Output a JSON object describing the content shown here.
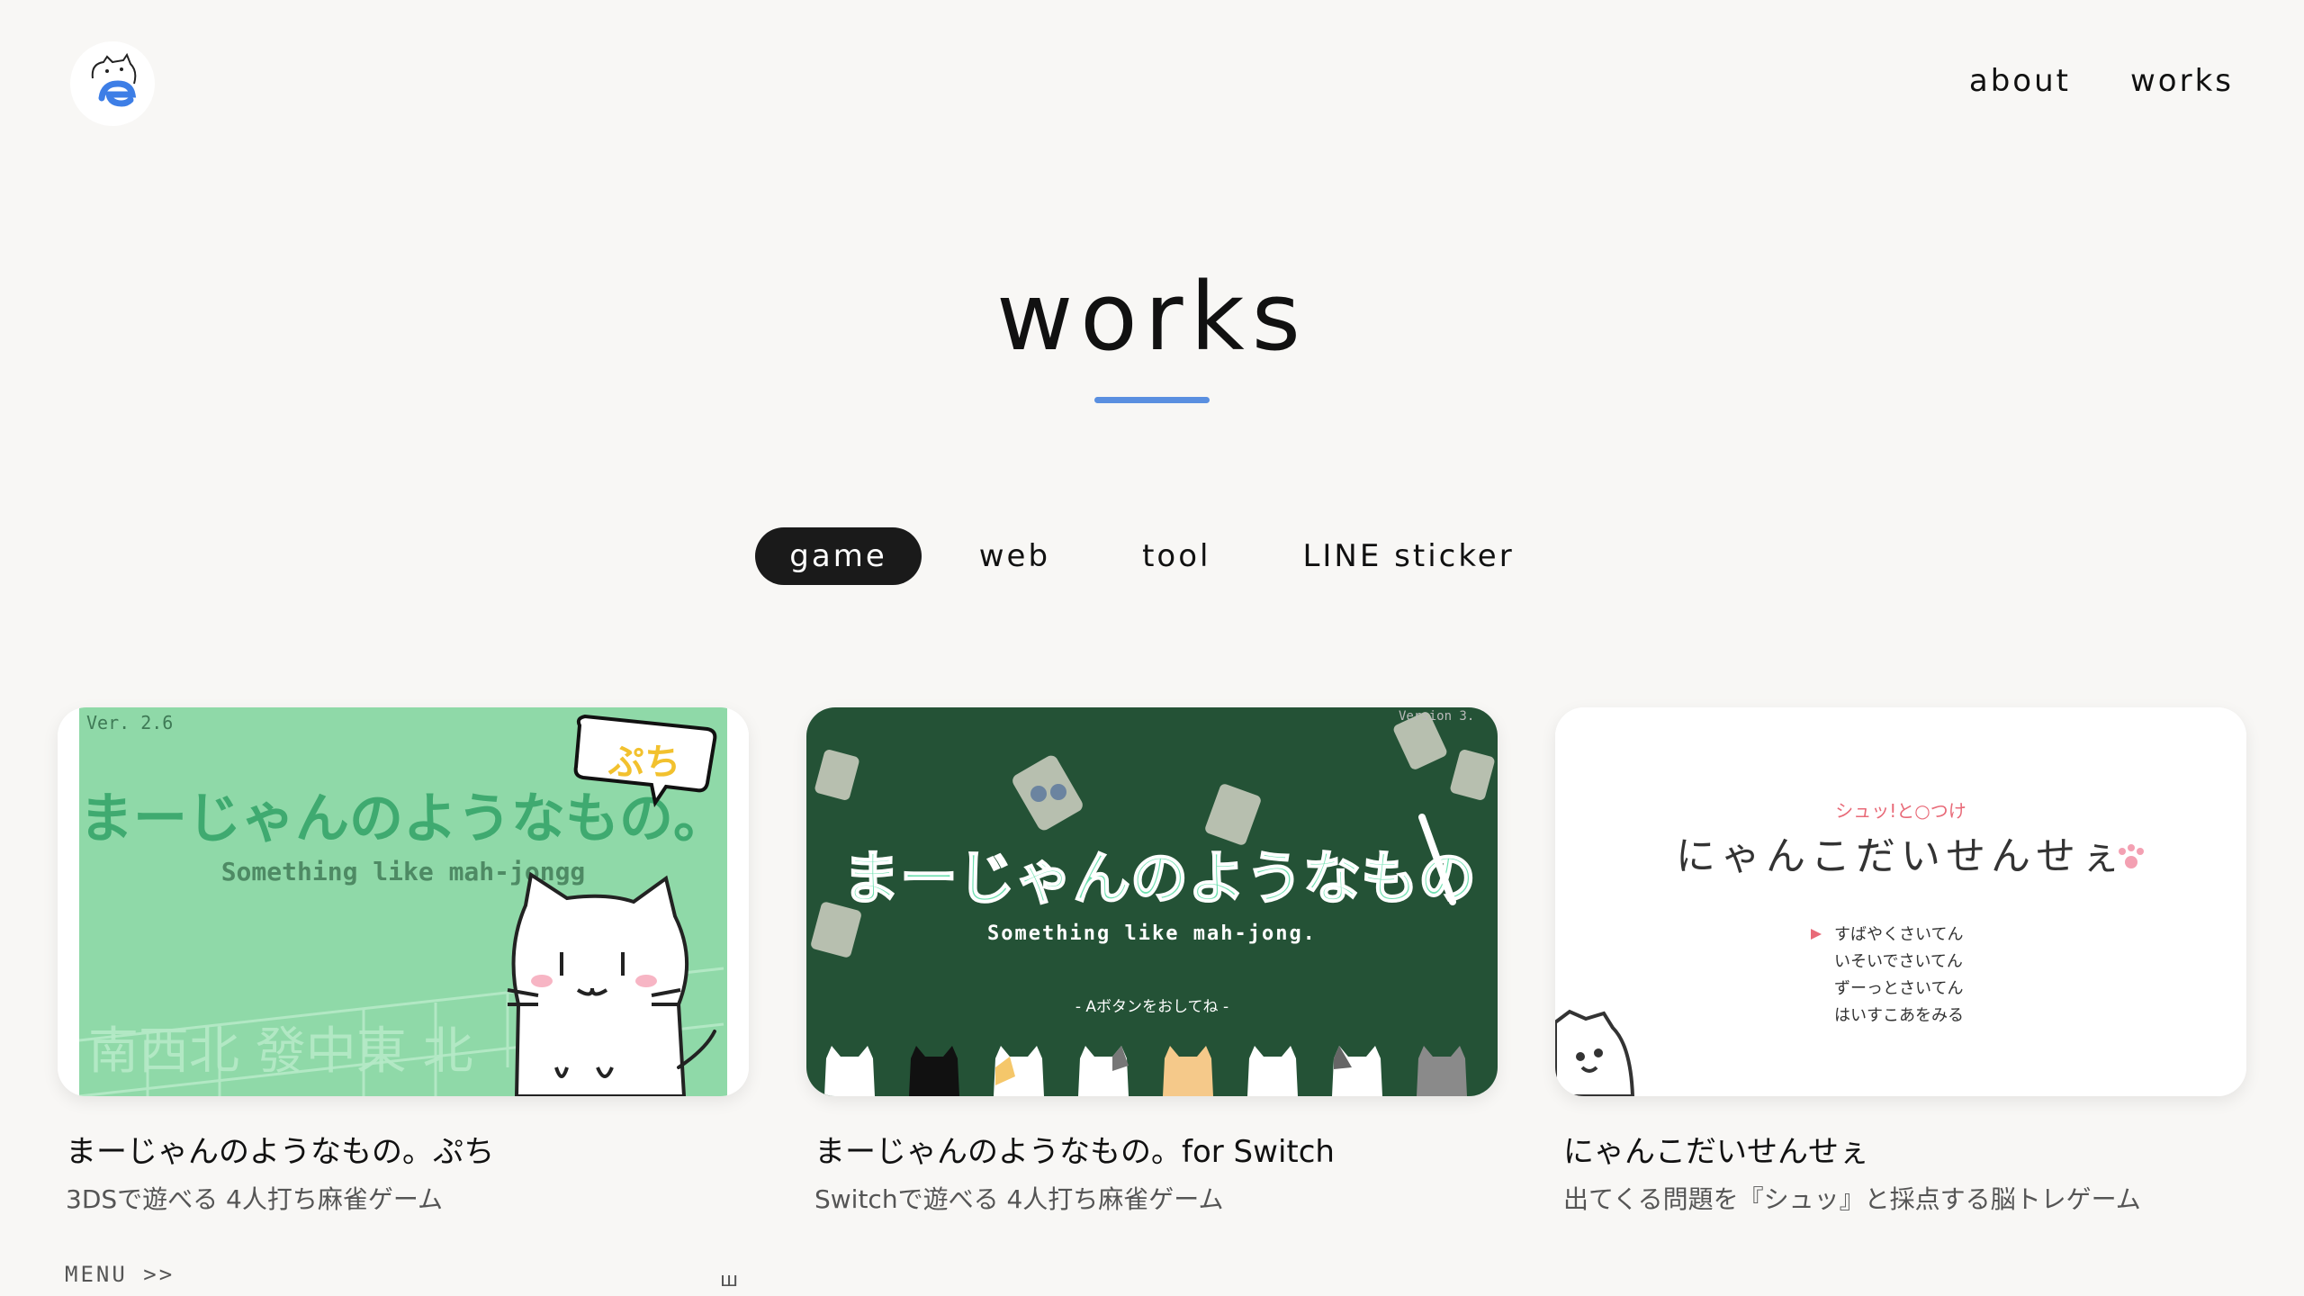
{
  "header": {
    "nav": [
      {
        "label": "about"
      },
      {
        "label": "works"
      }
    ]
  },
  "page": {
    "title": "works"
  },
  "tabs": [
    {
      "label": "game",
      "active": true
    },
    {
      "label": "web",
      "active": false
    },
    {
      "label": "tool",
      "active": false
    },
    {
      "label": "LINE sticker",
      "active": false
    }
  ],
  "cards": [
    {
      "title": "まーじゃんのようなもの。ぷち",
      "description": "3DSで遊べる 4人打ち麻雀ゲーム",
      "thumb": {
        "version": "Ver. 2.6",
        "logo": "まーじゃんのようなもの。",
        "subtitle": "Something like mah-jongg",
        "badge": "ぷち",
        "tiles": "南西北 發中東 北"
      }
    },
    {
      "title": "まーじゃんのようなもの。for Switch",
      "description": "Switchで遊べる 4人打ち麻雀ゲーム",
      "thumb": {
        "version": "Version 3.",
        "logo": "まーじゃんのようなもの",
        "subtitle": "Something like mah-jong.",
        "prompt": "- Aボタンをおしてね -"
      }
    },
    {
      "title": "にゃんこだいせんせぇ",
      "description": "出てくる問題を『シュッ』と採点する脳トレゲーム",
      "thumb": {
        "tagline": "シュッ!と○つけ",
        "logo": "にゃんこだいせんせぇ",
        "menu": [
          "すばやくさいてん",
          "いそいでさいてん",
          "ずーっとさいてん",
          "はいすこあをみる"
        ]
      }
    }
  ],
  "footer": {
    "menu_label": "MENU >>",
    "mark": "ш"
  },
  "colors": {
    "accent": "#5a8fe0",
    "card1_bg": "#8fd9a8",
    "card2_bg": "#245236",
    "mint": "#6ee0b0"
  }
}
